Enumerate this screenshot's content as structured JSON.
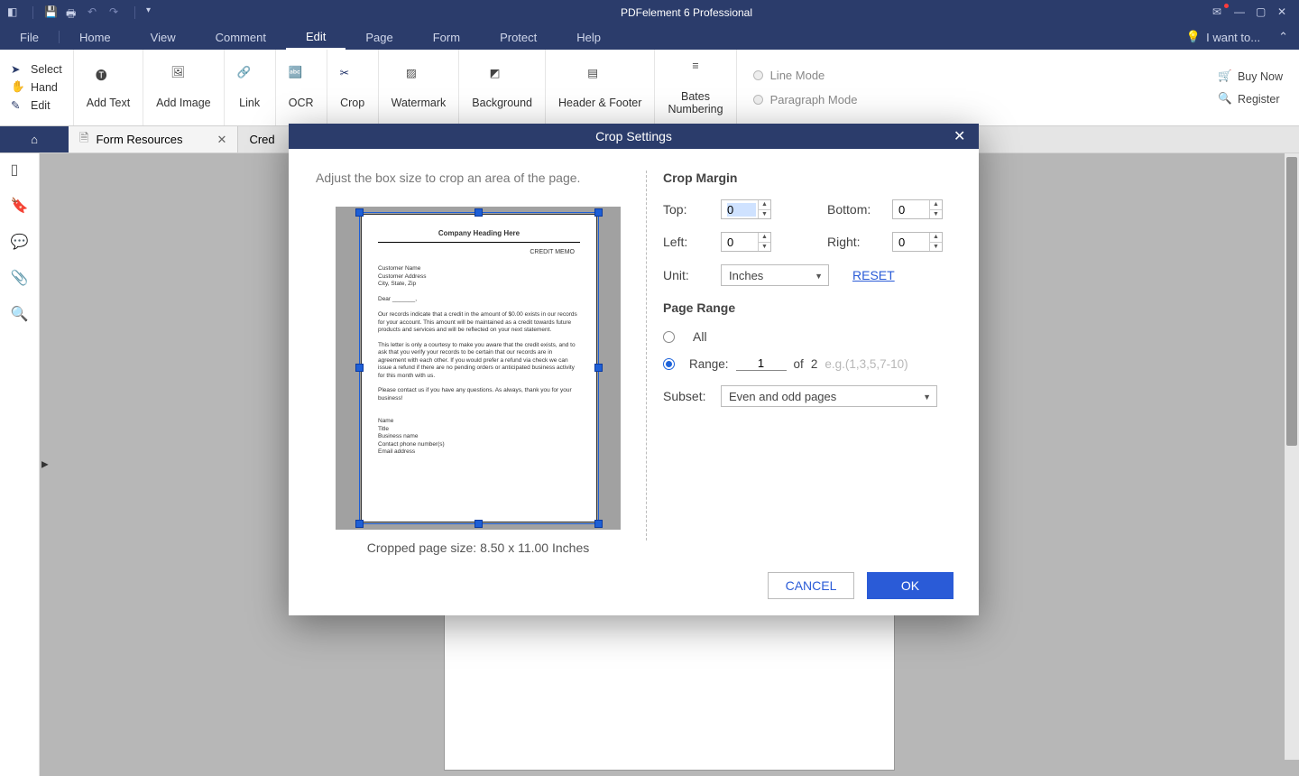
{
  "app_title": "PDFelement 6 Professional",
  "menubar": [
    "File",
    "Home",
    "View",
    "Comment",
    "Edit",
    "Page",
    "Form",
    "Protect",
    "Help"
  ],
  "menubar_active_index": 4,
  "iwant": "I want to...",
  "ribbon": {
    "tool_select": "Select",
    "tool_hand": "Hand",
    "tool_edit": "Edit",
    "add_text": "Add Text",
    "add_image": "Add Image",
    "link": "Link",
    "ocr": "OCR",
    "crop": "Crop",
    "watermark": "Watermark",
    "background": "Background",
    "header_footer": "Header & Footer",
    "bates": "Bates\nNumbering",
    "line_mode": "Line Mode",
    "para_mode": "Paragraph Mode",
    "buy_now": "Buy Now",
    "register": "Register"
  },
  "tabs": {
    "form_resources": "Form Resources",
    "other": "Cred"
  },
  "dialog": {
    "title": "Crop Settings",
    "instr": "Adjust the box size to crop an area of the page.",
    "cropped_size": "Cropped page size: 8.50 x 11.00 Inches",
    "section_margin": "Crop Margin",
    "top": "Top:",
    "bottom": "Bottom:",
    "left": "Left:",
    "right": "Right:",
    "unit": "Unit:",
    "unit_value": "Inches",
    "reset": "RESET",
    "section_range": "Page Range",
    "all": "All",
    "range": "Range:",
    "range_from": "1",
    "of": "of",
    "range_total": "2",
    "range_hint": "e.g.(1,3,5,7-10)",
    "subset": "Subset:",
    "subset_value": "Even and odd pages",
    "cancel": "CANCEL",
    "ok": "OK",
    "val_top": "0",
    "val_bottom": "0",
    "val_left": "0",
    "val_right": "0"
  },
  "preview_doc": {
    "heading": "Company Heading Here",
    "memo": "CREDIT MEMO",
    "addr1": "Customer Name",
    "addr2": "Customer Address",
    "addr3": "City, State, Zip"
  }
}
